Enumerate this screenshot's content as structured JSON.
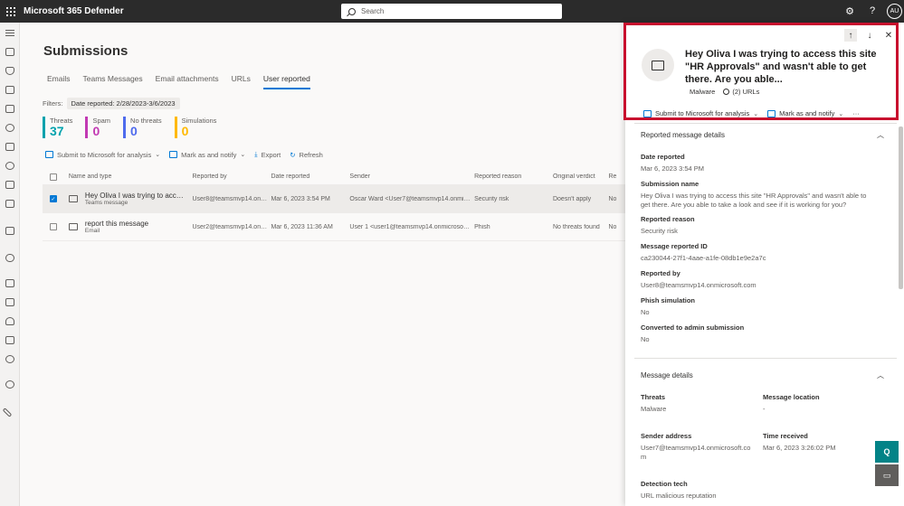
{
  "app": {
    "title": "Microsoft 365 Defender",
    "search_placeholder": "Search",
    "user_initials": "AU"
  },
  "main": {
    "page_title": "Submissions",
    "tabs": [
      {
        "label": "Emails",
        "active": false
      },
      {
        "label": "Teams Messages",
        "active": false
      },
      {
        "label": "Email attachments",
        "active": false
      },
      {
        "label": "URLs",
        "active": false
      },
      {
        "label": "User reported",
        "active": true
      }
    ],
    "filters_label": "Filters:",
    "filter_pill": "Date reported: 2/28/2023-3/6/2023",
    "stats": [
      {
        "label": "Threats",
        "value": "37",
        "color": "#00a2ad"
      },
      {
        "label": "Spam",
        "value": "0",
        "color": "#c239b3"
      },
      {
        "label": "No threats",
        "value": "0",
        "color": "#4f6bed"
      },
      {
        "label": "Simulations",
        "value": "0",
        "color": "#ffb900"
      }
    ],
    "toolbar": {
      "submit": "Submit to Microsoft for analysis",
      "mark": "Mark as and notify",
      "export": "Export",
      "refresh": "Refresh"
    },
    "table": {
      "headers": [
        "Name and type",
        "Reported by",
        "Date reported",
        "Sender",
        "Reported reason",
        "Original verdict",
        "Re"
      ],
      "rows": [
        {
          "name": "Hey Oliva I was trying to access ...",
          "type": "Teams message",
          "reported_by": "User8@teamsmvp14.onmicr...",
          "date": "Mar 6, 2023 3:54 PM",
          "sender": "Oscar Ward <User7@teamsmvp14.onmicrosoft....",
          "reason": "Security risk",
          "verdict": "Doesn't apply",
          "extra": "No",
          "selected": true
        },
        {
          "name": "report this message",
          "type": "Email",
          "reported_by": "User2@teamsmvp14.onmicr...",
          "date": "Mar 6, 2023 11:36 AM",
          "sender": "User 1 <user1@teamsmvp14.onmicrosoft.com>",
          "reason": "Phish",
          "verdict": "No threats found",
          "extra": "No",
          "selected": false
        }
      ]
    }
  },
  "panel": {
    "title": "Hey Oliva I was trying to access this site \"HR Approvals\" and wasn't able to get there. Are you able...",
    "tag_malware": "Malware",
    "tag_urls": "(2) URLs",
    "action_submit": "Submit to Microsoft for analysis",
    "action_mark": "Mark as and notify",
    "reported_section": {
      "header": "Reported message details",
      "fields": [
        {
          "label": "Date reported",
          "value": "Mar 6, 2023 3:54 PM"
        },
        {
          "label": "Submission name",
          "value": "Hey Oliva I was trying to access this site \"HR Approvals\" and wasn't able to get there. Are you able to take a look and see if it is working for you?"
        },
        {
          "label": "Reported reason",
          "value": "Security risk"
        },
        {
          "label": "Message reported ID",
          "value": "ca230044-27f1-4aae-a1fe-08db1e9e2a7c"
        },
        {
          "label": "Reported by",
          "value": "User8@teamsmvp14.onmicrosoft.com"
        },
        {
          "label": "Phish simulation",
          "value": "No"
        },
        {
          "label": "Converted to admin submission",
          "value": "No"
        }
      ]
    },
    "message_section": {
      "header": "Message details",
      "threats_label": "Threats",
      "threats_value": "Malware",
      "location_label": "Message location",
      "location_value": "-",
      "sender_label": "Sender address",
      "sender_value": "User7@teamsmvp14.onmicrosoft.co m",
      "time_label": "Time received",
      "time_value": "Mar 6, 2023 3:26:02 PM",
      "detection_label": "Detection tech",
      "detection_value": "URL malicious reputation"
    }
  }
}
